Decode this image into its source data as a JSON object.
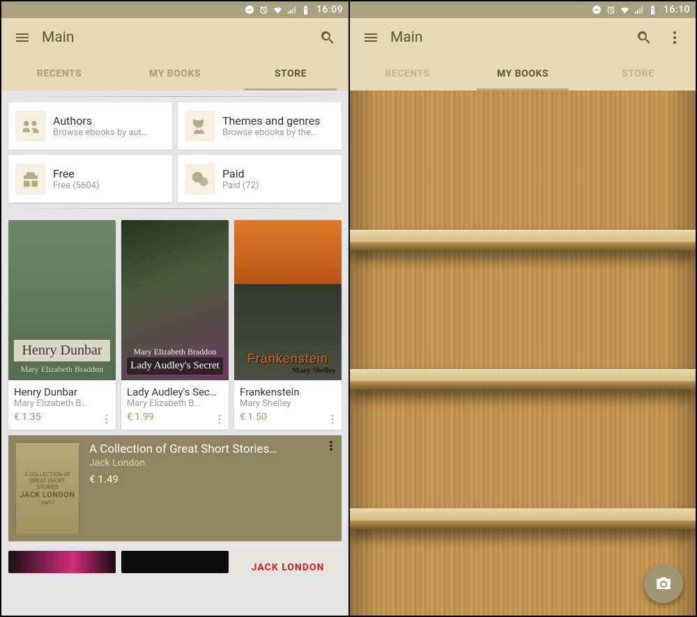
{
  "left": {
    "status": {
      "time": "16:09"
    },
    "header": {
      "title": "Main"
    },
    "tabs": {
      "recents": "RECENTS",
      "mybooks": "MY BOOKS",
      "store": "STORE",
      "active": "store"
    },
    "categories": [
      {
        "title": "Authors",
        "subtitle": "Browse ebooks by aut…",
        "icon": "author"
      },
      {
        "title": "Themes and genres",
        "subtitle": "Browse ebooks by the…",
        "icon": "genre"
      },
      {
        "title": "Free",
        "subtitle": "Free (5604)",
        "icon": "gift"
      },
      {
        "title": "Paid",
        "subtitle": "Paid (72)",
        "icon": "coins"
      }
    ],
    "books": [
      {
        "title": "Henry Dunbar",
        "author": "Mary Elizabeth B…",
        "price": "€ 1.35",
        "cover_title": "Henry Dunbar",
        "cover_author": "Mary Elizabeth Braddon"
      },
      {
        "title": "Lady Audley's Sec…",
        "author": "Mary Elizabeth B…",
        "price": "€ 1.99",
        "cover_title": "Lady Audley's Secret",
        "cover_author": "Mary Elizabeth Braddon"
      },
      {
        "title": "Frankenstein",
        "author": "Mary Shelley",
        "price": "€ 1.50",
        "cover_title": "Frankenstein",
        "cover_author": "Mary Shelley"
      }
    ],
    "feature": {
      "title": "A Collection of Great Short Stories…",
      "author": "Jack London",
      "price": "€ 1.49",
      "cover_line1": "A COLLECTION OF",
      "cover_line2": "GREAT SHORT STORIES",
      "cover_line3": "JACK LONDON",
      "cover_line4": "part I"
    },
    "peek3": "JACK LONDON"
  },
  "right": {
    "status": {
      "time": "16:10"
    },
    "header": {
      "title": "Main"
    },
    "tabs": {
      "recents": "RECENTS",
      "mybooks": "MY BOOKS",
      "store": "STORE",
      "active": "mybooks"
    }
  }
}
